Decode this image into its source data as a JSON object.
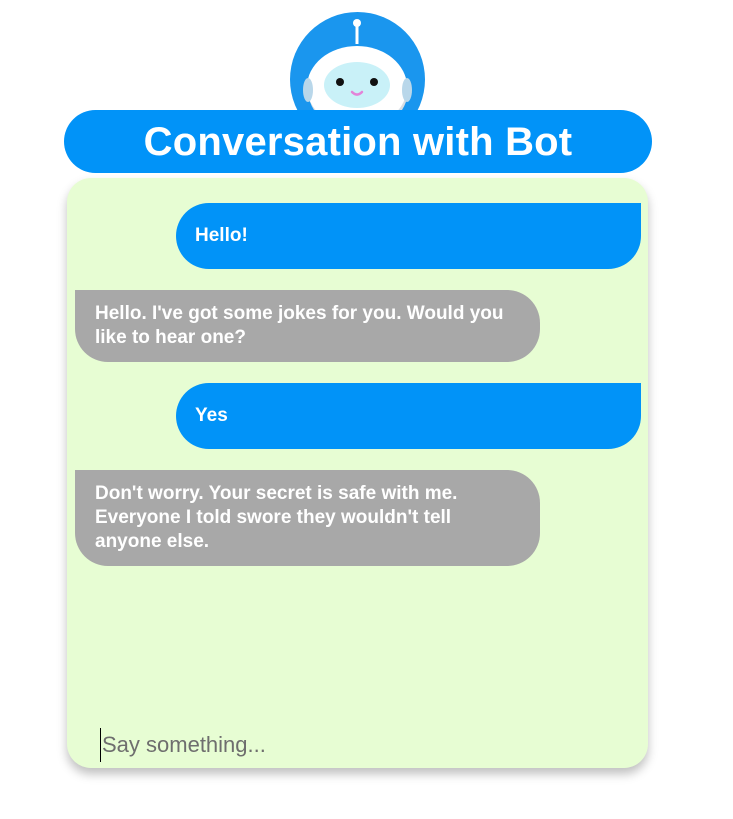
{
  "header": {
    "title": "Conversation with Bot"
  },
  "avatar": {
    "icon": "robot-face-icon"
  },
  "messages": [
    {
      "sender": "user",
      "text": "Hello!"
    },
    {
      "sender": "bot",
      "text": "Hello. I've got some jokes for you. Would you like to hear one?"
    },
    {
      "sender": "user",
      "text": "Yes"
    },
    {
      "sender": "bot",
      "text": "Don't worry. Your secret is safe with me. Everyone I told swore they wouldn't tell anyone else."
    }
  ],
  "input": {
    "value": "",
    "placeholder": "Say something..."
  },
  "colors": {
    "accent": "#0193f8",
    "bot_bubble": "#a8a8a8",
    "panel_background": "#e7fdd3"
  }
}
